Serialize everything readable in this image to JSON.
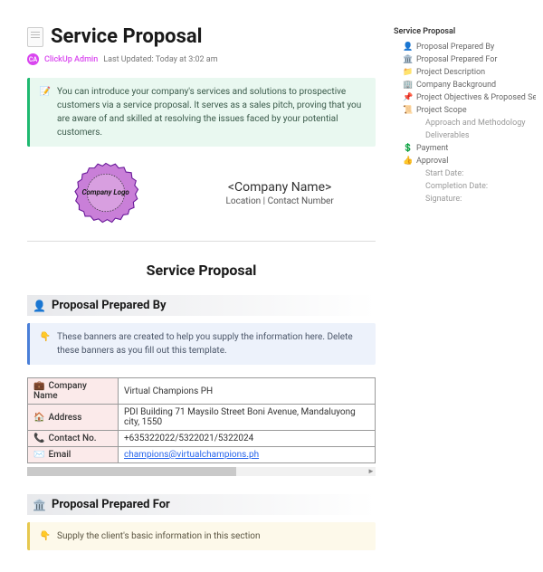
{
  "page": {
    "title": "Service Proposal",
    "author": "ClickUp Admin",
    "avatar_initials": "CA",
    "last_updated_label": "Last Updated: Today at 3:02 am"
  },
  "banners": {
    "intro": "You can introduce your company's services and solutions to prospective customers via a service proposal. It serves as a sales pitch, proving that you are aware of and skilled at resolving the issues faced by your potential customers.",
    "prepared_by_help": "These banners are created to help you supply the information here. Delete these banners as you fill out this template.",
    "prepared_for_help": "Supply the client's basic information in this section"
  },
  "header_block": {
    "logo_text": "Company Logo",
    "company_name": "<Company Name>",
    "location_line": "Location | Contact Number"
  },
  "main_heading": "Service Proposal",
  "sections": {
    "prepared_by": "Proposal Prepared By",
    "prepared_for": "Proposal Prepared For"
  },
  "company_table": {
    "rows": [
      {
        "icon": "💼",
        "label": "Company Name",
        "value": "Virtual Champions PH"
      },
      {
        "icon": "🏠",
        "label": "Address",
        "value": "PDI Building 71 Maysilo Street Boni Avenue, Mandaluyong city, 1550"
      },
      {
        "icon": "📞",
        "label": "Contact No.",
        "value": "+635322022/5322021/5322024"
      },
      {
        "icon": "✉️",
        "label": "Email",
        "value": "champions@virtualchampions.ph",
        "link": true
      }
    ]
  },
  "toc": {
    "title": "Service Proposal",
    "items": [
      {
        "icon": "👤",
        "label": "Proposal Prepared By"
      },
      {
        "icon": "🏛️",
        "label": "Proposal Prepared For"
      },
      {
        "icon": "📁",
        "label": "Project Description",
        "color": "#e6a817"
      },
      {
        "icon": "🏢",
        "label": "Company Background"
      },
      {
        "icon": "📌",
        "label": "Project Objectives & Proposed Ser...",
        "color": "#e64545"
      },
      {
        "icon": "📜",
        "label": "Project Scope",
        "color": "#e6c84f"
      },
      {
        "icon": "",
        "label": "Approach and Methodology",
        "sub": true
      },
      {
        "icon": "",
        "label": "Deliverables",
        "sub": true
      },
      {
        "icon": "💲",
        "label": "Payment",
        "color": "#3cc0b0"
      },
      {
        "icon": "👍",
        "label": "Approval",
        "color": "#e6c84f"
      },
      {
        "icon": "",
        "label": "Start Date:",
        "sub": true
      },
      {
        "icon": "",
        "label": "Completion Date:",
        "sub": true
      },
      {
        "icon": "",
        "label": "Signature:",
        "sub": true
      }
    ]
  }
}
